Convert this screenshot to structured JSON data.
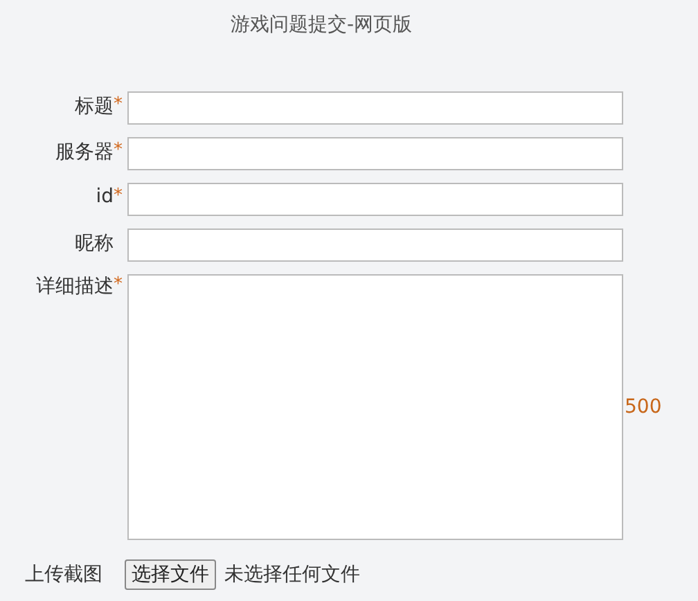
{
  "title": "游戏问题提交-网页版",
  "fields": [
    {
      "label": "标题",
      "mark": "*",
      "kind": "input"
    },
    {
      "label": "服务器",
      "mark": "*",
      "kind": "input"
    },
    {
      "label": "id",
      "mark": "*",
      "kind": "input"
    },
    {
      "label": "昵称",
      "kind": "input"
    },
    {
      "label": "详细描述",
      "mark": "*",
      "kind": "textarea",
      "counter": "500"
    }
  ],
  "upload": {
    "label": "上传截图",
    "button": "选择文件",
    "status": "未选择任何文件"
  }
}
